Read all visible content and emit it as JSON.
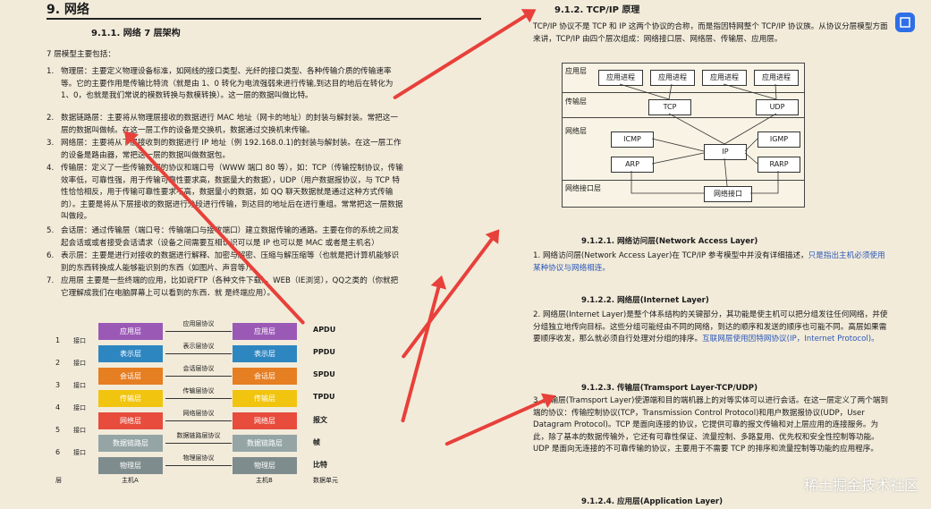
{
  "left": {
    "h1": "9. 网络",
    "h2": "9.1.1.  网络 7 层架构",
    "intro": "7 层模型主要包括：",
    "items": [
      {
        "n": "1.",
        "text": "物理层：主要定义物理设备标准，如网线的接口类型、光纤的接口类型、各种传输介质的传输速率等。它的主要作用是传输比特流（就是由 1、0 转化为电流强弱来进行传输,到达目的地后在转化为 1、0，也就是我们常说的模数转换与数模转换）。这一层的数据叫做比特。"
      },
      {
        "n": "2.",
        "text": "数据链路层：主要将从物理层接收的数据进行 MAC 地址（网卡的地址）的封装与解封装。常把这一层的数据叫做帧。在这一层工作的设备是交换机，数据通过交换机来传输。"
      },
      {
        "n": "3.",
        "text": "网络层：主要将从下层接收到的数据进行 IP 地址（例 192.168.0.1)的封装与解封装。在这一层工作的设备是路由器，常把这一层的数据叫做数据包。"
      },
      {
        "n": "4.",
        "text": "传输层：定义了一些传输数据的协议和端口号（WWW 端口 80 等），如：TCP（传输控制协议，传输效率低，可靠性强，用于传输可靠性要求高，数据量大的数据），UDP（用户数据报协议，与 TCP 特性恰恰相反，用于传输可靠性要求不高，数据量小的数据，如 QQ 聊天数据就是通过这种方式传输的）。主要是将从下层接收的数据进行分段进行传输，到达目的地址后在进行重组。常常把这一层数据叫做段。"
      },
      {
        "n": "5.",
        "text": "会话层：通过传输层（端口号：传输端口与接收端口）建立数据传输的通路。主要在你的系统之间发起会话或或者接受会话请求（设备之间需要互相认识可以是 IP 也可以是 MAC 或者是主机名）"
      },
      {
        "n": "6.",
        "text": "表示层：主要是进行对接收的数据进行解释、加密与解密、压缩与解压缩等（也就是把计算机能够识别的东西转换成人能够能识别的东西（如图片、声音等））"
      },
      {
        "n": "7.",
        "text": "应用层 主要是一些终端的应用，比如说FTP（各种文件下载），WEB（IE浏览），QQ之类的（你就把它理解成我们在电脑屏幕上可以看到的东西．就 是终端应用）。"
      }
    ],
    "osi": {
      "layers": [
        "应用层",
        "表示层",
        "会话层",
        "传输层",
        "网络层",
        "数据链路层",
        "物理层"
      ],
      "protocols": [
        "应用层协议",
        "表示层协议",
        "会话层协议",
        "传输层协议",
        "网络层协议",
        "数据链路层协议",
        "物理层协议"
      ],
      "units": [
        "APDU",
        "PPDU",
        "SPDU",
        "TPDU",
        "报文",
        "帧",
        "比特"
      ],
      "nums": [
        "6",
        "5",
        "4",
        "3",
        "2",
        "1"
      ],
      "iface": "接口",
      "host_a": "主机A",
      "host_b": "主机B",
      "col_layer": "层",
      "col_unit": "数据单元",
      "colors": [
        "#9b59b6",
        "#2e86c1",
        "#e67e22",
        "#f1c40f",
        "#e74c3c",
        "#95a5a6",
        "#7f8c8d"
      ]
    }
  },
  "right": {
    "h2a": "9.1.2.  TCP/IP 原理",
    "p1": "TCP/IP 协议不是 TCP 和 IP 这两个协议的合称，而是指因特网整个 TCP/IP 协议族。从协议分层模型方面来讲，TCP/IP 由四个层次组成：网络接口层、网络层、传输层、应用层。",
    "fig": {
      "layers": [
        "应用层",
        "传输层",
        "网络层",
        "网络接口层"
      ],
      "app": "应用进程",
      "tcp": "TCP",
      "udp": "UDP",
      "icmp": "ICMP",
      "igmp": "IGMP",
      "ip": "IP",
      "arp": "ARP",
      "rarp": "RARP",
      "nic": "网络接口"
    },
    "h3a": "9.1.2.1.    网络访问层(Network Access Layer)",
    "p2a": "网络访问层(Network Access Layer)在 TCP/IP 参考模型中并没有详细描述，",
    "p2b": "只是指出主机必须使用某种协议与网络相连。",
    "h3b": "9.1.2.2.    网络层(Internet Layer)",
    "p3": "网络层(Internet Layer)是整个体系结构的关键部分，其功能是使主机可以把分组发往任何网络，并使分组独立地传向目标。这些分组可能经由不同的网络，到达的顺序和发送的顺序也可能不同。高层如果需要顺序收发，那么就必须自行处理对分组的排序。",
    "p3link": "互联网层使用因特网协议(IP，Internet Protocol)。",
    "h3c": "9.1.2.3.    传输层(Tramsport Layer-TCP/UDP)",
    "p4": "传输层(Tramsport Layer)使源端和目的端机器上的对等实体可以进行会话。在这一层定义了两个端到端的协议：传输控制协议(TCP，Transmission Control Protocol)和用户数据报协议(UDP，User Datagram Protocol)。TCP 是面向连接的协议，它提供可靠的报文传输和对上层应用的连接服务。为此，除了基本的数据传输外，它还有可靠性保证、流量控制、多路复用、优先权和安全性控制等功能。UDP 是面向无连接的不可靠传输的协议，主要用于不需要 TCP 的排序和流量控制等功能的应用程序。",
    "h3d": "9.1.2.4.    应用层(Application Layer)",
    "nums": [
      "1.",
      "2.",
      "3."
    ]
  },
  "watermark": "稀土掘金技术社区",
  "accent": "#e8403a"
}
